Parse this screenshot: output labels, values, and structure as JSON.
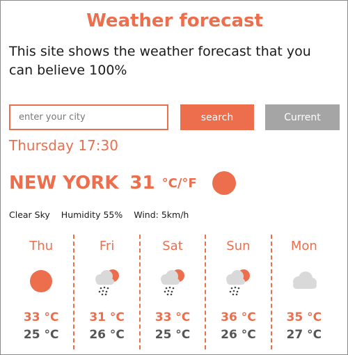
{
  "header": {
    "title": "Weather forecast",
    "tagline": "This site shows the weather forecast that you can believe 100%"
  },
  "search": {
    "placeholder": "enter your city",
    "value": "",
    "search_label": "search",
    "current_label": "Current"
  },
  "current": {
    "datetime": "Thursday 17:30",
    "city": "NEW YORK",
    "temperature": "31",
    "units": "°C/°F",
    "icon": "sun-icon",
    "condition": "Clear Sky",
    "humidity": "Humidity 55%",
    "wind": "Wind: 5km/h"
  },
  "forecast": [
    {
      "day": "Thu",
      "icon": "sun-icon",
      "max": "33 °C",
      "min": "25 °C"
    },
    {
      "day": "Fri",
      "icon": "cloud-sun-rain-icon",
      "max": "31 °C",
      "min": "26 °C"
    },
    {
      "day": "Sat",
      "icon": "cloud-sun-rain-icon",
      "max": "33 °C",
      "min": "25 °C"
    },
    {
      "day": "Sun",
      "icon": "cloud-sun-rain-icon",
      "max": "36 °C",
      "min": "26 °C"
    },
    {
      "day": "Mon",
      "icon": "cloud-icon",
      "max": "35 °C",
      "min": "27 °C"
    }
  ],
  "colors": {
    "accent": "#ec6e4c",
    "button_gray": "#a5a5a5",
    "cloud": "#d9d9d9",
    "text_dark": "#1a1a1a",
    "min_temp": "#555555"
  }
}
